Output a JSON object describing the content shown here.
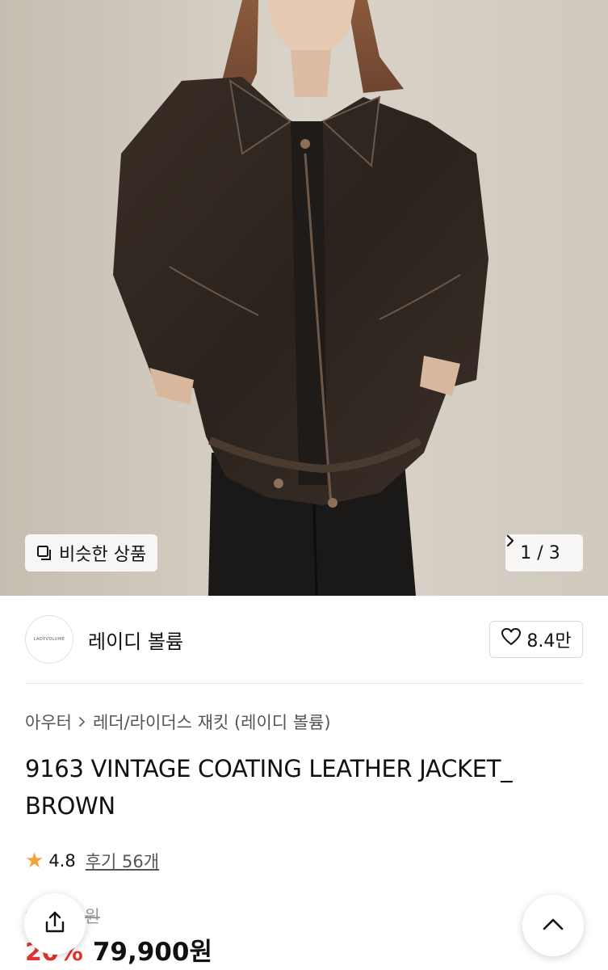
{
  "gallery": {
    "similar_label": "비슷한 상품",
    "counter": "1 / 3"
  },
  "shop": {
    "logo_text": "LADYVOLUME",
    "name": "레이디 볼륨",
    "likes": "8.4만"
  },
  "breadcrumb": {
    "level1": "아우터",
    "level2": "레더/라이더스 재킷 (레이디 볼륨)"
  },
  "product": {
    "title": "9163 VINTAGE COATING LEATHER JACKET_ BROWN",
    "rating": "4.8",
    "reviews": "후기 56개",
    "original_price": "99,900원",
    "discount": "20%",
    "price": "79,900원"
  },
  "colors": {
    "star": "#f2a33a",
    "discount": "#e2352b"
  },
  "icons": {
    "similar": "copy-squares-icon",
    "next": "chevron-right-icon",
    "like": "heart-outline-icon",
    "share": "share-upload-icon",
    "top": "chevron-up-icon"
  }
}
